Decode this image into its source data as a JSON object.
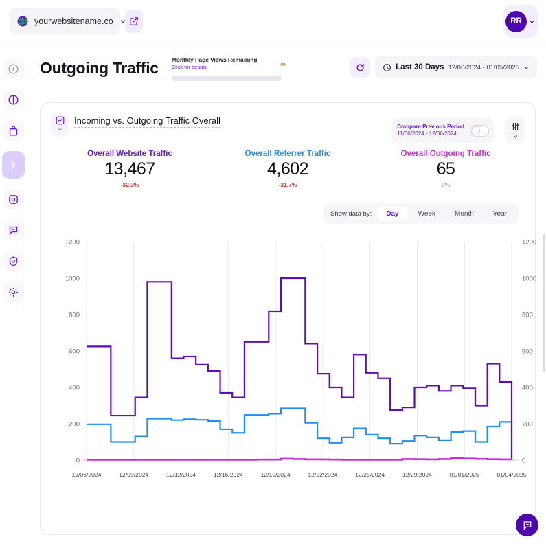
{
  "topbar": {
    "site_name": "yourwebsitename.co",
    "globe_icon": "globe-icon",
    "dropdown_icon": "chevron-down-icon",
    "external_link_icon": "external-link-icon",
    "avatar_initials": "RR",
    "avatar_chevron_icon": "chevron-down-icon"
  },
  "sidebar": {
    "items": [
      {
        "icon": "plus-circle-icon",
        "name": "sidebar-item-add",
        "active": false,
        "muted": true
      },
      {
        "icon": "pie-chart-icon",
        "name": "sidebar-item-analytics",
        "active": false,
        "muted": false
      },
      {
        "icon": "bag-icon",
        "name": "sidebar-item-ecommerce",
        "active": false,
        "muted": false
      },
      {
        "icon": "broadcast-icon",
        "name": "sidebar-item-traffic",
        "active": true,
        "muted": false
      },
      {
        "icon": "target-icon",
        "name": "sidebar-item-goals",
        "active": false,
        "muted": false
      },
      {
        "icon": "chat-icon",
        "name": "sidebar-item-messages",
        "active": false,
        "muted": false
      },
      {
        "icon": "shield-check-icon",
        "name": "sidebar-item-security",
        "active": false,
        "muted": false
      },
      {
        "icon": "gear-icon",
        "name": "sidebar-item-settings",
        "active": false,
        "muted": false
      }
    ]
  },
  "header": {
    "title": "Outgoing Traffic",
    "quota_title": "Monthly Page Views Remaining",
    "quota_link": "Click for details",
    "quota_infinity": "∞",
    "refresh_icon": "refresh-icon",
    "clock_icon": "clock-icon",
    "date_label": "Last 30 Days",
    "date_range": "12/06/2024 - 01/05/2025",
    "date_chevron_icon": "chevron-down-icon"
  },
  "card": {
    "header_icon": "chart-box-icon",
    "title": "Incoming vs. Outgoing Traffic Overall",
    "compare_label": "Compare Previous Period",
    "compare_range": "11/06/2024 - 12/06/2024",
    "compare_toggle_state": "off",
    "filter_icon": "sliders-icon",
    "kpis": [
      {
        "label": "Overall Website Traffic",
        "value": "13,467",
        "delta": "-32.3%",
        "color": "#6415d8",
        "delta_color": "#ef2424"
      },
      {
        "label": "Overall Referrer Traffic",
        "value": "4,602",
        "delta": "-31.7%",
        "color": "#1f8df5",
        "delta_color": "#ef2424"
      },
      {
        "label": "Overall Outgoing Traffic",
        "value": "65",
        "delta": "0%",
        "color": "#cc29dd",
        "delta_color": "#a6a6b2"
      }
    ],
    "segmented": {
      "lead": "Show data by:",
      "options": [
        "Day",
        "Week",
        "Month",
        "Year"
      ],
      "selected": "Day"
    }
  },
  "chat": {
    "icon": "chat-bubble-icon"
  },
  "chart_data": {
    "type": "line",
    "step": true,
    "title": "Incoming vs. Outgoing Traffic Overall",
    "xlabel": "",
    "ylabel": "",
    "ylim": [
      0,
      1200
    ],
    "yticks": [
      0,
      200,
      400,
      600,
      800,
      1000,
      1200
    ],
    "grid": "vertical",
    "dual_axis": true,
    "legend_position": "none",
    "x_tick_labels": [
      "12/06/2024",
      "12/09/2024",
      "12/12/2024",
      "12/16/2024",
      "12/19/2024",
      "12/22/2024",
      "12/25/2024",
      "12/29/2024",
      "01/01/2025",
      "01/04/2025"
    ],
    "x": [
      "12/06/2024",
      "12/07/2024",
      "12/08/2024",
      "12/09/2024",
      "12/10/2024",
      "12/11/2024",
      "12/12/2024",
      "12/13/2024",
      "12/14/2024",
      "12/15/2024",
      "12/16/2024",
      "12/17/2024",
      "12/18/2024",
      "12/19/2024",
      "12/20/2024",
      "12/21/2024",
      "12/22/2024",
      "12/23/2024",
      "12/24/2024",
      "12/25/2024",
      "12/26/2024",
      "12/27/2024",
      "12/28/2024",
      "12/29/2024",
      "12/30/2024",
      "12/31/2024",
      "01/01/2025",
      "01/02/2025",
      "01/03/2025",
      "01/04/2025",
      "01/05/2025"
    ],
    "series": [
      {
        "name": "Overall Website Traffic",
        "color": "#5c0cbe",
        "values": [
          625,
          625,
          245,
          245,
          345,
          980,
          980,
          560,
          570,
          525,
          490,
          370,
          345,
          650,
          650,
          815,
          1000,
          1000,
          640,
          475,
          400,
          345,
          580,
          480,
          450,
          275,
          290,
          400,
          410,
          380,
          410,
          395,
          300,
          530,
          430,
          60
        ]
      },
      {
        "name": "Overall Referrer Traffic",
        "color": "#1f8df5",
        "values": [
          197,
          197,
          100,
          100,
          130,
          228,
          228,
          220,
          225,
          222,
          215,
          170,
          150,
          248,
          248,
          255,
          285,
          285,
          205,
          120,
          95,
          125,
          175,
          140,
          120,
          90,
          105,
          135,
          125,
          110,
          155,
          160,
          100,
          185,
          210,
          10
        ]
      },
      {
        "name": "Overall Outgoing Traffic",
        "color": "#cc29dd",
        "values": [
          2,
          2,
          2,
          2,
          2,
          2,
          2,
          2,
          2,
          2,
          2,
          2,
          2,
          2,
          3,
          3,
          8,
          6,
          4,
          4,
          3,
          2,
          2,
          2,
          2,
          2,
          6,
          5,
          4,
          6,
          10,
          9,
          7,
          5,
          4,
          3
        ]
      }
    ]
  }
}
